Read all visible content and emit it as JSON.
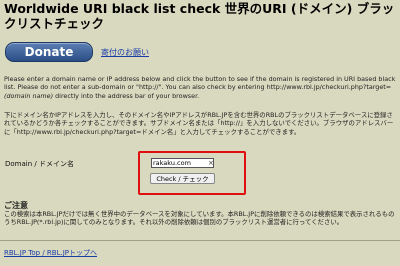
{
  "header": {
    "title": "Worldwide URI black list check 世界のURI (ドメイン) ブラックリストチェック"
  },
  "donate": {
    "button_label": "Donate",
    "link_text": "寄付のお願い"
  },
  "intro": {
    "en_part1": "Please enter a domain name or IP address below and click the button to see if the domain is registered in URI based black list. Please do not enter a sub-domain or \"http://\". You can also check by entering http://www.rbl.jp/checkuri.php?target=",
    "en_var": "(domain name)",
    "en_part2": " directly into the address bar of your browser.",
    "ja_text": "下にドメイン名かIPアドレスを入力し、そのドメイン名やIPアドレスがRBL.JPを含む世界のRBLのブラックリストデータベースに登録されているかどうか各チェックすることができます。サブドメイン名または「http://」を入力しないでください。ブラウザのアドレスバーに「http://www.rbl.jp/checkuri.php?target=ドメイン名」と入力してチェックすることができます。"
  },
  "form": {
    "label": "Domain / ドメイン名",
    "input_value": "rakaku.com",
    "clear_glyph": "×",
    "submit_label": "Check / チェック"
  },
  "notice": {
    "heading": "ご注意",
    "body": "この検索は本RBL.JPだけでは無く世界中のデータベースを対象にしています。本RBL.JPに削除依頼できるのは検索結果で表示されるものうちRBL.JP(*.rbl.jp)に関してのみとなります。それ以外の削除依頼は個別のブラックリスト運営者に行ってください。"
  },
  "footer": {
    "links_text": "RBL.JP Top / RBL.JPトップへ"
  }
}
